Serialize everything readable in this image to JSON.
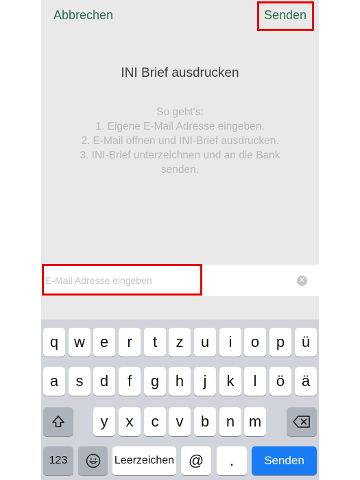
{
  "nav": {
    "cancel_label": "Abbrechen",
    "send_label": "Senden"
  },
  "main": {
    "title": "INI Brief ausdrucken",
    "instructions": [
      "So geht's:",
      "1. Eigene E-Mail Adresse eingeben.",
      "2. E-Mail öffnen und INI-Brief ausdrucken.",
      "3. INI-Brief unterzeichnen und an die Bank",
      "senden."
    ]
  },
  "email_field": {
    "placeholder": "E-Mail Adresse eingeben",
    "value": ""
  },
  "keyboard": {
    "row1": [
      "q",
      "w",
      "e",
      "r",
      "t",
      "z",
      "u",
      "i",
      "o",
      "p",
      "ü"
    ],
    "row2": [
      "a",
      "s",
      "d",
      "f",
      "g",
      "h",
      "j",
      "k",
      "l",
      "ö",
      "ä"
    ],
    "row3": [
      "y",
      "x",
      "c",
      "v",
      "b",
      "n",
      "m"
    ],
    "numbers_label": "123",
    "space_label": "Leerzeichen",
    "at_label": "@",
    "dot_label": ".",
    "send_label": "Senden"
  },
  "colors": {
    "accent": "#2f6b4f",
    "keyboard_send": "#1a7cf4",
    "highlight": "#e60000"
  }
}
